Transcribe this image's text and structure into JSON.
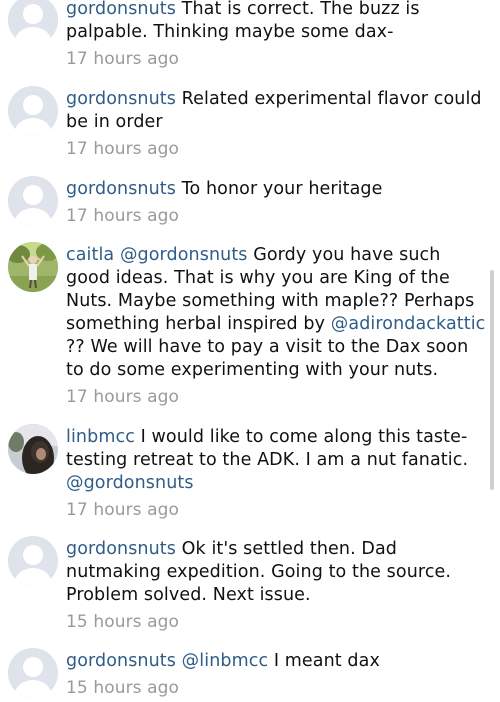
{
  "comments": [
    {
      "username": "gordonsnuts",
      "mention": "",
      "text": "That is correct. The buzz is palpable. Thinking maybe some dax-",
      "time": "17 hours ago",
      "avatar": "default"
    },
    {
      "username": "gordonsnuts",
      "mention": "",
      "text": "Related experimental flavor could be in order",
      "time": "17 hours ago",
      "avatar": "default"
    },
    {
      "username": "gordonsnuts",
      "mention": "",
      "text": "To honor your heritage",
      "time": "17 hours ago",
      "avatar": "default"
    },
    {
      "username": "caitla",
      "mention": "@gordonsnuts",
      "text": "Gordy you have such good ideas. That is why you are King of the Nuts. Maybe something with maple?? Perhaps something herbal inspired by",
      "mention2": "@adirondackattic",
      "text2": "?? We will have to pay a visit to the Dax soon to do some experimenting with your nuts.",
      "time": "17 hours ago",
      "avatar": "photo-outdoor"
    },
    {
      "username": "linbmcc",
      "mention": "",
      "text": "I would like to come along this taste-testing retreat to the ADK. I am a nut fanatic.",
      "mention_end": "@gordonsnuts",
      "time": "17 hours ago",
      "avatar": "photo-person"
    },
    {
      "username": "gordonsnuts",
      "mention": "",
      "text": "Ok it's settled then. Dad nutmaking expedition. Going to the source. Problem solved. Next issue.",
      "time": "15 hours ago",
      "avatar": "default"
    },
    {
      "username": "gordonsnuts",
      "mention": "@linbmcc",
      "text": "I meant dax",
      "time": "15 hours ago",
      "avatar": "default"
    }
  ],
  "colors": {
    "username": "#2f5d88",
    "time": "#9a9a9a",
    "text": "#111111"
  }
}
